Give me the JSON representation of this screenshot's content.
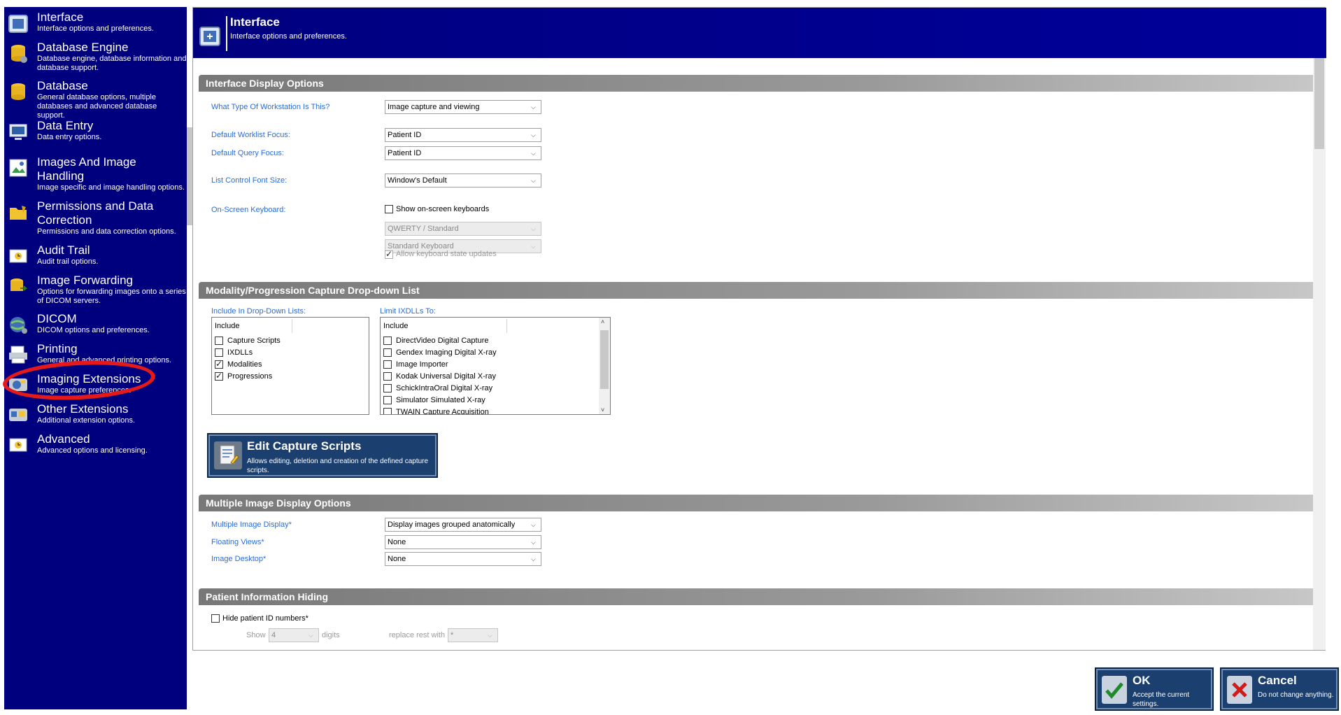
{
  "sidebar": {
    "items": [
      {
        "title": "Interface",
        "desc": "Interface options and preferences.",
        "icon": "interface-icon"
      },
      {
        "title": "Database Engine",
        "desc": "Database engine, database information and database support.",
        "icon": "database-engine-icon"
      },
      {
        "title": "Database",
        "desc": "General database options, multiple databases and advanced database support.",
        "icon": "database-icon"
      },
      {
        "title": "Data Entry",
        "desc": "Data entry options.",
        "icon": "data-entry-icon"
      },
      {
        "title": "Images And Image Handling",
        "desc": "Image specific and image handling options.",
        "icon": "images-icon"
      },
      {
        "title": "Permissions and Data Correction",
        "desc": "Permissions and data correction options.",
        "icon": "permissions-icon"
      },
      {
        "title": "Audit Trail",
        "desc": "Audit trail options.",
        "icon": "audit-trail-icon"
      },
      {
        "title": "Image Forwarding",
        "desc": "Options for forwarding images onto a series of DICOM servers.",
        "icon": "image-forwarding-icon"
      },
      {
        "title": "DICOM",
        "desc": "DICOM options and preferences.",
        "icon": "dicom-icon"
      },
      {
        "title": "Printing",
        "desc": "General and advanced printing options.",
        "icon": "printer-icon"
      },
      {
        "title": "Imaging Extensions",
        "desc": "Image capture preferences.",
        "icon": "imaging-extensions-icon"
      },
      {
        "title": "Other Extensions",
        "desc": "Additional extension options.",
        "icon": "other-extensions-icon"
      },
      {
        "title": "Advanced",
        "desc": "Advanced options and licensing.",
        "icon": "advanced-icon"
      }
    ]
  },
  "header": {
    "title": "Interface",
    "subtitle": "Interface options and preferences."
  },
  "sections": {
    "display": "Interface Display Options",
    "modality": "Modality/Progression Capture Drop-down List",
    "multi_image": "Multiple Image Display Options",
    "patient_hiding": "Patient Information Hiding"
  },
  "display_options": {
    "workstation_label": "What Type Of Workstation Is This?",
    "workstation_value": "Image capture and viewing",
    "worklist_label": "Default Worklist Focus:",
    "worklist_value": "Patient ID",
    "query_label": "Default Query Focus:",
    "query_value": "Patient ID",
    "font_label": "List Control Font Size:",
    "font_value": "Window's Default",
    "keyboard_label": "On-Screen Keyboard:",
    "show_keyboard": "Show on-screen keyboards",
    "layout_value": "QWERTY / Standard",
    "keyboard_value": "Standard Keyboard",
    "allow_updates": "Allow keyboard state updates"
  },
  "modality": {
    "include_label": "Include In Drop-Down Lists:",
    "include_header": "Include",
    "include_items": [
      {
        "label": "Capture Scripts",
        "checked": false
      },
      {
        "label": "IXDLLs",
        "checked": false
      },
      {
        "label": "Modalities",
        "checked": true
      },
      {
        "label": "Progressions",
        "checked": true
      }
    ],
    "limit_label": "Limit IXDLLs To:",
    "limit_header": "Include",
    "limit_items": [
      {
        "label": "DirectVideo Digital Capture",
        "checked": false
      },
      {
        "label": "Gendex Imaging Digital X-ray",
        "checked": false
      },
      {
        "label": "Image Importer",
        "checked": false
      },
      {
        "label": "Kodak Universal Digital X-ray",
        "checked": false
      },
      {
        "label": "SchickIntraOral Digital X-ray",
        "checked": false
      },
      {
        "label": "Simulator Simulated X-ray",
        "checked": false
      },
      {
        "label": "TWAIN Capture Acquisition",
        "checked": false
      }
    ],
    "edit_title": "Edit Capture Scripts",
    "edit_desc": "Allows editing, deletion and creation of the defined capture scripts."
  },
  "multi_image": {
    "display_label": "Multiple Image Display*",
    "display_value": "Display images grouped anatomically",
    "floating_label": "Floating Views*",
    "floating_value": "None",
    "desktop_label": "Image Desktop*",
    "desktop_value": "None"
  },
  "patient_hiding": {
    "hide_label": "Hide patient ID numbers*",
    "show_label": "Show",
    "digits_value": "4",
    "digits_label": "digits",
    "replace_label": "replace rest with",
    "replace_value": "*"
  },
  "footer": {
    "ok_title": "OK",
    "ok_desc": "Accept the current settings.",
    "cancel_title": "Cancel",
    "cancel_desc": "Do not change anything."
  },
  "colors": {
    "sidebar_bg": "#00007f",
    "label_blue": "#2a6cd6",
    "button_bg": "#1b3f6e",
    "highlight": "#e51919"
  }
}
